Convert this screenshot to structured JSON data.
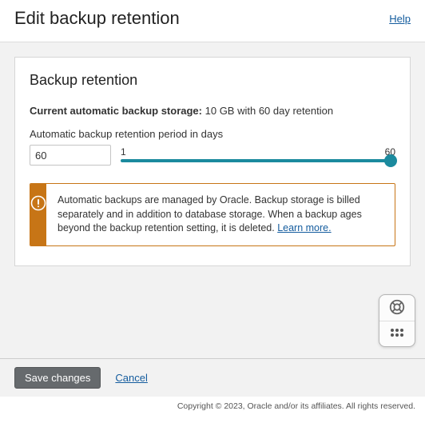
{
  "header": {
    "title": "Edit backup retention",
    "help": "Help"
  },
  "panel": {
    "heading": "Backup retention",
    "current_label": "Current automatic backup storage:",
    "current_value": "10 GB with 60 day retention",
    "field_label": "Automatic backup retention period in days",
    "value": "60",
    "min_label": "1",
    "max_label": "60"
  },
  "info": {
    "text": "Automatic backups are managed by Oracle. Backup storage is billed separately and in addition to database storage. When a backup ages beyond the backup retention setting, it is deleted.",
    "learn_more": "Learn more."
  },
  "footer": {
    "save": "Save changes",
    "cancel": "Cancel"
  },
  "copyright": "Copyright © 2023, Oracle and/or its affiliates. All rights reserved."
}
